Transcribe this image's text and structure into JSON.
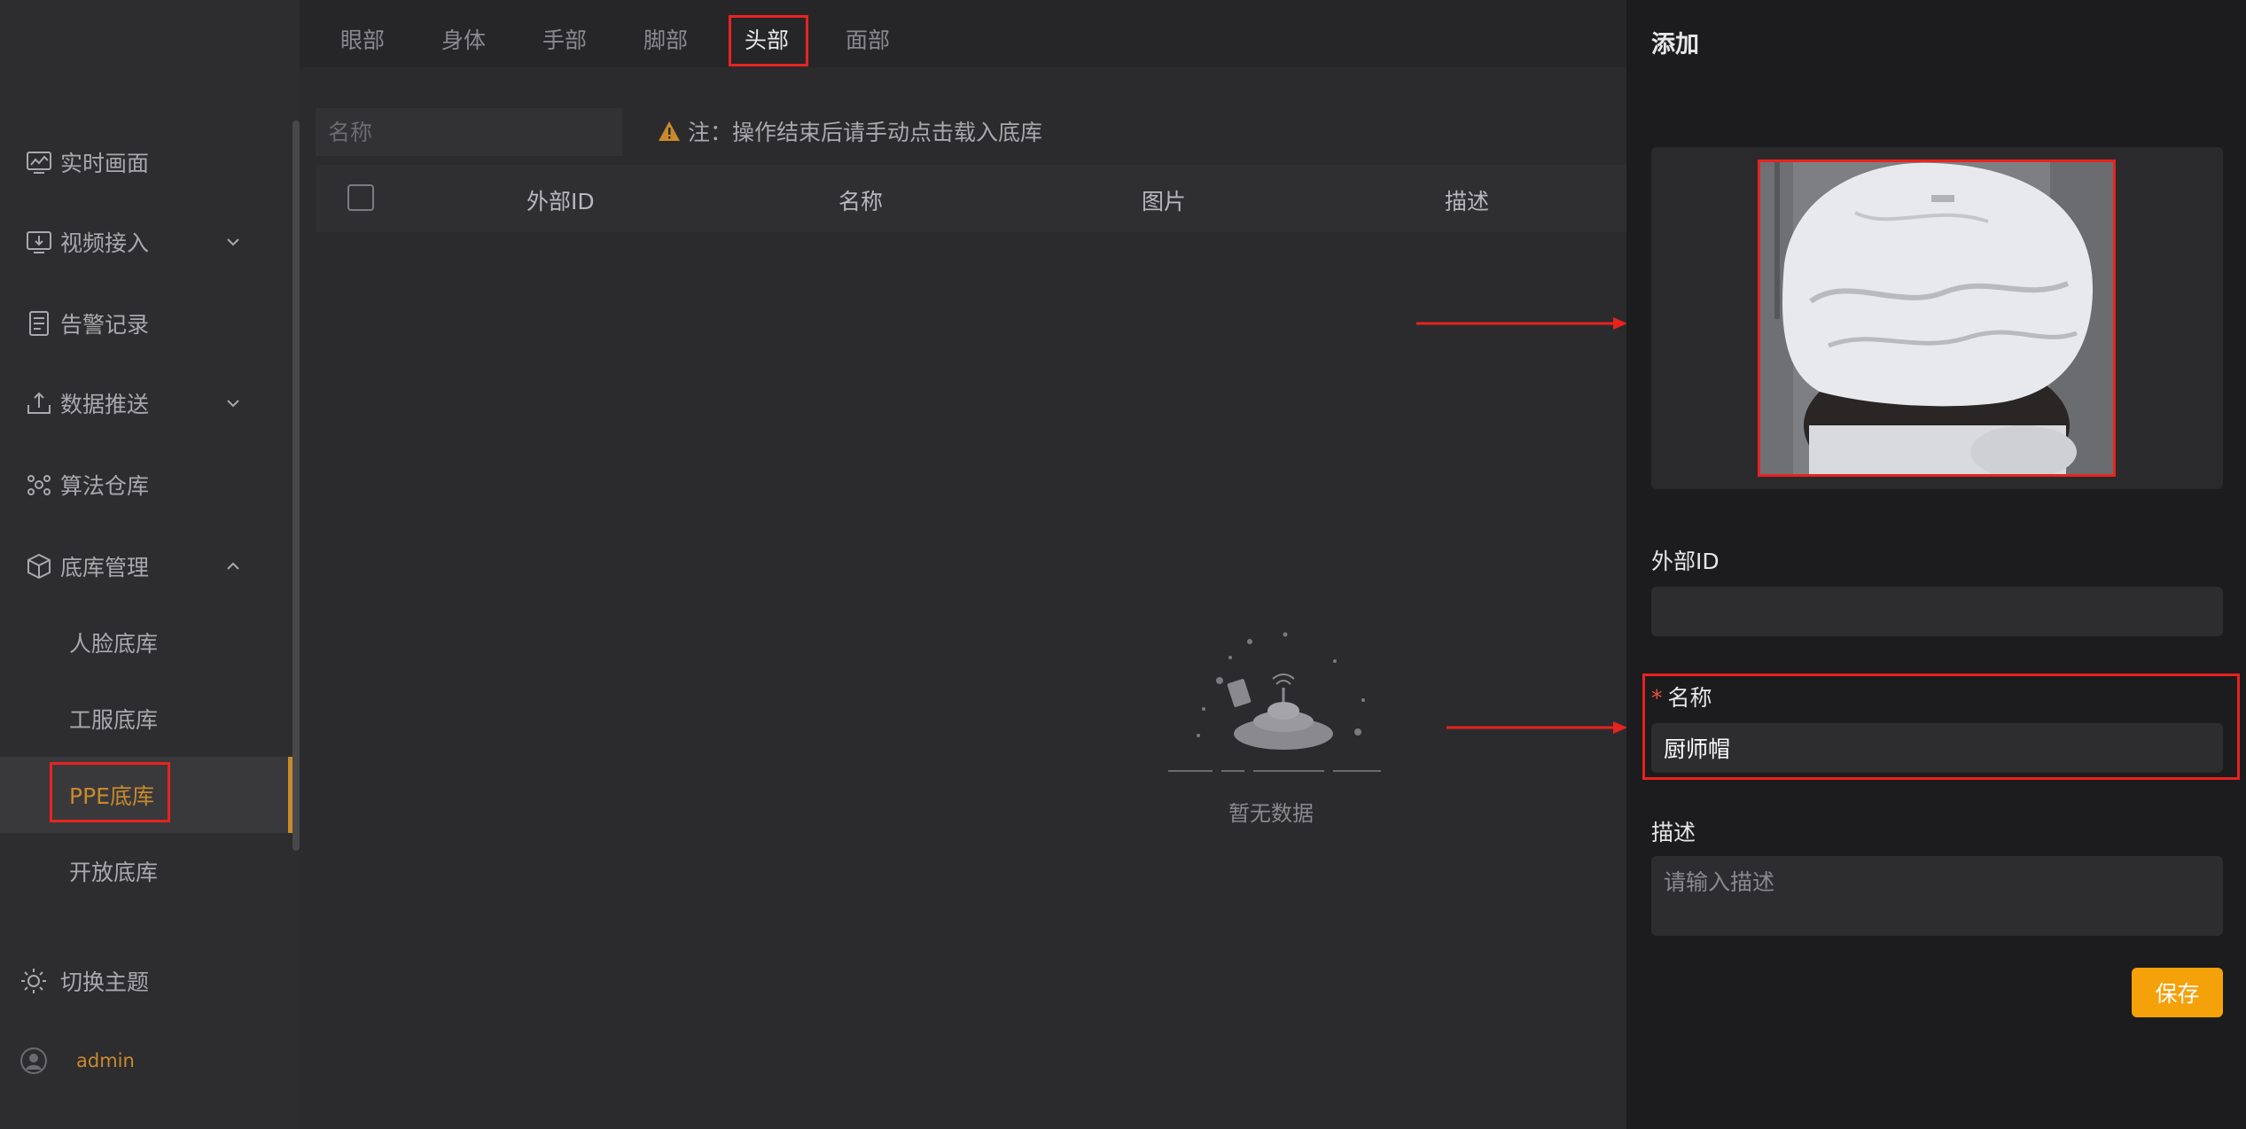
{
  "sidebar": {
    "items": [
      {
        "label": "实时画面",
        "icon": "chart-monitor-icon"
      },
      {
        "label": "视频接入",
        "icon": "monitor-download-icon"
      },
      {
        "label": "告警记录",
        "icon": "document-list-icon"
      },
      {
        "label": "数据推送",
        "icon": "upload-tray-icon"
      },
      {
        "label": "算法仓库",
        "icon": "network-nodes-icon"
      },
      {
        "label": "底库管理",
        "icon": "cube-icon"
      }
    ],
    "subitems": [
      "人脸底库",
      "工服底库",
      "PPE底库",
      "开放底库"
    ],
    "theme_label": "切换主题",
    "user_label": "admin"
  },
  "tabs": [
    "眼部",
    "身体",
    "手部",
    "脚部",
    "头部",
    "面部"
  ],
  "active_tab": "头部",
  "search": {
    "placeholder": "名称"
  },
  "note": "注：操作结束后请手动点击载入底库",
  "table": {
    "columns": [
      "外部ID",
      "名称",
      "图片",
      "描述"
    ]
  },
  "empty_text": "暂无数据",
  "panel": {
    "title": "添加",
    "external_id_label": "外部ID",
    "external_id_value": "",
    "name_required_mark": "*",
    "name_label": "名称",
    "name_value": "厨师帽",
    "desc_label": "描述",
    "desc_placeholder": "请输入描述",
    "save_label": "保存"
  },
  "colors": {
    "accent": "#f5a10a",
    "active_text": "#c88a2c",
    "highlight": "#e8231f"
  }
}
